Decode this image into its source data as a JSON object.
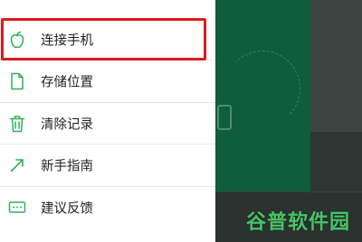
{
  "menu": {
    "items": [
      {
        "label": "连接手机",
        "icon": "apple-icon"
      },
      {
        "label": "存储位置",
        "icon": "file-icon"
      },
      {
        "label": "清除记录",
        "icon": "trash-icon"
      },
      {
        "label": "新手指南",
        "icon": "arrow-icon"
      },
      {
        "label": "建议反馈",
        "icon": "feedback-icon"
      }
    ]
  },
  "accent_color": "#2fb05e",
  "highlight_color": "#e01a1a",
  "watermark": "谷普软件园"
}
